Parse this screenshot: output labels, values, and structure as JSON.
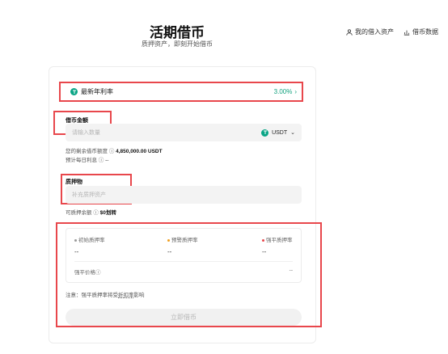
{
  "header": {
    "title": "活期借币",
    "subtitle": "质押资产，即刻开始借币"
  },
  "top_links": {
    "my_assets": "我的借入资产",
    "borrow_data": "借币数据"
  },
  "rate": {
    "label": "最新年利率",
    "value": "3.00%",
    "chevron": "›"
  },
  "borrow": {
    "label": "借币金额",
    "placeholder": "请输入数量",
    "coin": "USDT",
    "remaining_label": "您的剩余借币额度",
    "remaining_value": "4,850,000.00 USDT",
    "daily_interest_label": "预计每日利息",
    "daily_interest_value": "--"
  },
  "collateral": {
    "label": "质押物",
    "placeholder": "补充质押资产",
    "available_label": "可质押余额",
    "available_value": "$0",
    "transfer": "划转"
  },
  "ratios": {
    "initial_label": "初始质押率",
    "initial_value": "--",
    "warning_label": "预警质押率",
    "warning_value": "--",
    "liquidation_label": "强平质押率",
    "liquidation_value": "--",
    "liq_price_label": "强平价格",
    "liq_price_value": "--"
  },
  "note": {
    "prefix": "注意：强平质押率将受",
    "link": "折扣率",
    "suffix": "影响"
  },
  "submit_label": "立即借币",
  "colors": {
    "accent_green": "#14a37f",
    "annotation_red": "#e8474c",
    "dot_initial": "#999999",
    "dot_warning": "#f0a020",
    "dot_liquidation": "#e8474c"
  }
}
